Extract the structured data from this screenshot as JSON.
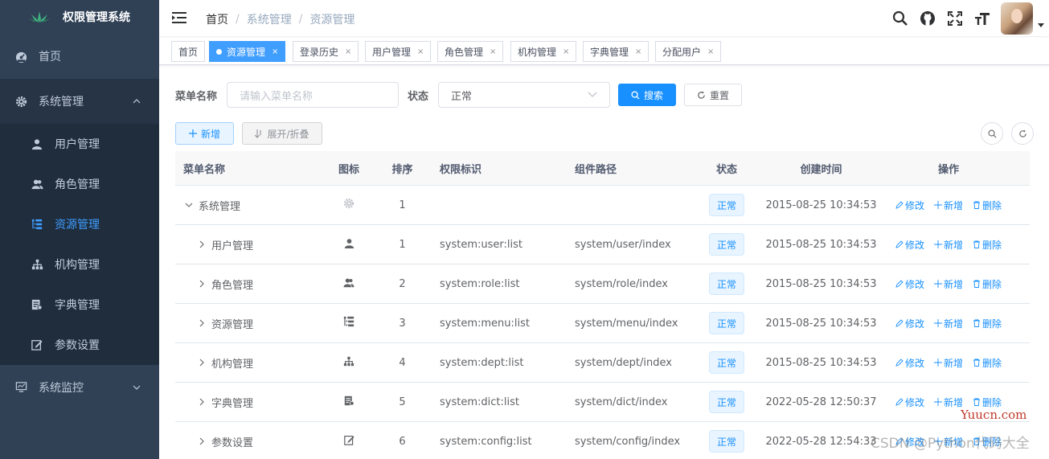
{
  "app": {
    "title": "权限管理系统"
  },
  "sidebar": {
    "items": [
      {
        "label": "首页",
        "icon": "dashboard-icon"
      },
      {
        "label": "系统管理",
        "icon": "gear-icon",
        "expanded": true
      },
      {
        "label": "系统监控",
        "icon": "monitor-icon"
      }
    ],
    "sub_items": [
      {
        "label": "用户管理",
        "icon": "user-icon"
      },
      {
        "label": "角色管理",
        "icon": "peoples-icon"
      },
      {
        "label": "资源管理",
        "icon": "tree-table-icon",
        "active": true
      },
      {
        "label": "机构管理",
        "icon": "tree-icon"
      },
      {
        "label": "字典管理",
        "icon": "dict-icon"
      },
      {
        "label": "参数设置",
        "icon": "edit-icon"
      }
    ]
  },
  "navbar": {
    "breadcrumb": [
      "首页",
      "系统管理",
      "资源管理"
    ],
    "tools": [
      "search-icon",
      "github-icon",
      "fullscreen-icon",
      "font-size-icon"
    ]
  },
  "tags": [
    {
      "label": "首页"
    },
    {
      "label": "资源管理",
      "active": true
    },
    {
      "label": "登录历史"
    },
    {
      "label": "用户管理"
    },
    {
      "label": "角色管理"
    },
    {
      "label": "机构管理"
    },
    {
      "label": "字典管理"
    },
    {
      "label": "分配用户"
    }
  ],
  "search": {
    "name_label": "菜单名称",
    "name_placeholder": "请输入菜单名称",
    "status_label": "状态",
    "status_value": "正常",
    "search_button": "搜索",
    "reset_button": "重置"
  },
  "toolbar": {
    "add_button": "新增",
    "toggle_button": "展开/折叠"
  },
  "table": {
    "headers": [
      "菜单名称",
      "图标",
      "排序",
      "权限标识",
      "组件路径",
      "状态",
      "创建时间",
      "操作"
    ],
    "actions": [
      "修改",
      "新增",
      "删除"
    ],
    "rows": [
      {
        "name": "系统管理",
        "icon": "gear-icon",
        "order": "1",
        "perms": "",
        "component": "",
        "status": "正常",
        "created": "2015-08-25 10:34:53",
        "level": 0,
        "expanded": true
      },
      {
        "name": "用户管理",
        "icon": "user-icon",
        "order": "1",
        "perms": "system:user:list",
        "component": "system/user/index",
        "status": "正常",
        "created": "2015-08-25 10:34:53",
        "level": 1
      },
      {
        "name": "角色管理",
        "icon": "peoples-icon",
        "order": "2",
        "perms": "system:role:list",
        "component": "system/role/index",
        "status": "正常",
        "created": "2015-08-25 10:34:53",
        "level": 1
      },
      {
        "name": "资源管理",
        "icon": "tree-table-icon",
        "order": "3",
        "perms": "system:menu:list",
        "component": "system/menu/index",
        "status": "正常",
        "created": "2015-08-25 10:34:53",
        "level": 1
      },
      {
        "name": "机构管理",
        "icon": "tree-icon",
        "order": "4",
        "perms": "system:dept:list",
        "component": "system/dept/index",
        "status": "正常",
        "created": "2015-08-25 10:34:53",
        "level": 1
      },
      {
        "name": "字典管理",
        "icon": "dict-icon",
        "order": "5",
        "perms": "system:dict:list",
        "component": "system/dict/index",
        "status": "正常",
        "created": "2022-05-28 12:50:37",
        "level": 1
      },
      {
        "name": "参数设置",
        "icon": "edit-icon",
        "order": "6",
        "perms": "system:config:list",
        "component": "system/config/index",
        "status": "正常",
        "created": "2022-05-28 12:54:33",
        "level": 1
      }
    ]
  },
  "watermark": {
    "text": "CSDN @Python代码大全",
    "site": "Yuucn.com"
  },
  "colors": {
    "sidebar_bg": "#304156",
    "submenu_bg": "#1f2d3d",
    "primary": "#1890ff",
    "active_menu": "#409eff"
  }
}
